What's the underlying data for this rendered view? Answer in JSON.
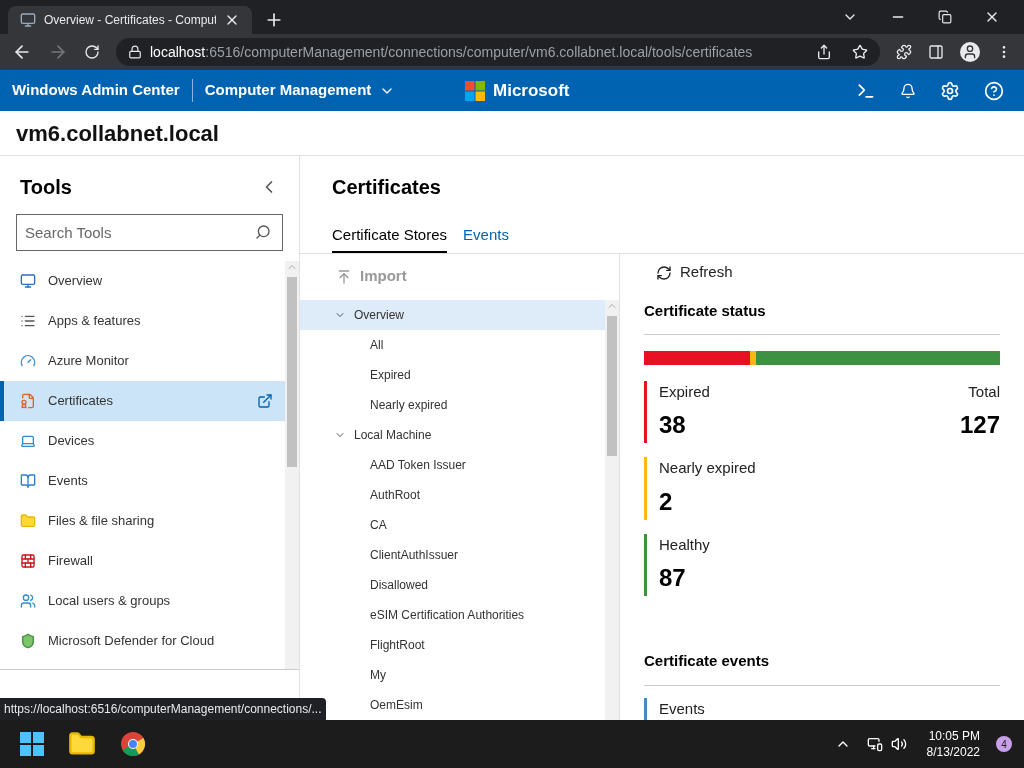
{
  "browser": {
    "tab_title": "Overview - Certificates - Comput",
    "address_host": "localhost",
    "address_path": ":6516/computerManagement/connections/computer/vm6.collabnet.local/tools/certificates",
    "status_url": "https://localhost:6516/computerManagement/connections/..."
  },
  "header": {
    "app_name": "Windows Admin Center",
    "context": "Computer Management",
    "brand": "Microsoft"
  },
  "server_name": "vm6.collabnet.local",
  "tools": {
    "title": "Tools",
    "search_placeholder": "Search Tools",
    "items": [
      {
        "label": "Overview",
        "selected": false
      },
      {
        "label": "Apps & features",
        "selected": false
      },
      {
        "label": "Azure Monitor",
        "selected": false
      },
      {
        "label": "Certificates",
        "selected": true
      },
      {
        "label": "Devices",
        "selected": false
      },
      {
        "label": "Events",
        "selected": false
      },
      {
        "label": "Files & file sharing",
        "selected": false
      },
      {
        "label": "Firewall",
        "selected": false
      },
      {
        "label": "Local users & groups",
        "selected": false
      },
      {
        "label": "Microsoft Defender for Cloud",
        "selected": false
      }
    ]
  },
  "page_title": "Certificates",
  "tabs": [
    {
      "label": "Certificate Stores",
      "selected": true
    },
    {
      "label": "Events",
      "selected": false
    }
  ],
  "import_label": "Import",
  "tree": [
    {
      "label": "Overview",
      "expanded": true,
      "selected": true,
      "children": [
        {
          "label": "All"
        },
        {
          "label": "Expired"
        },
        {
          "label": "Nearly expired"
        }
      ]
    },
    {
      "label": "Local Machine",
      "expanded": true,
      "selected": false,
      "children": [
        {
          "label": "AAD Token Issuer"
        },
        {
          "label": "AuthRoot"
        },
        {
          "label": "CA"
        },
        {
          "label": "ClientAuthIssuer"
        },
        {
          "label": "Disallowed"
        },
        {
          "label": "eSIM Certification Authorities"
        },
        {
          "label": "FlightRoot"
        },
        {
          "label": "My"
        },
        {
          "label": "OemEsim"
        }
      ]
    }
  ],
  "refresh_label": "Refresh",
  "status": {
    "title": "Certificate status",
    "total_label": "Total",
    "total": "127",
    "stats": [
      {
        "label": "Expired",
        "count": "38",
        "color": "#e81123",
        "level": 0.299
      },
      {
        "label": "Nearly expired",
        "count": "2",
        "color": "#fcb714",
        "level": 0.016
      },
      {
        "label": "Healthy",
        "count": "87",
        "color": "#3f9142",
        "level": 0.685
      }
    ]
  },
  "events": {
    "title": "Certificate events",
    "items": [
      {
        "label": "Events",
        "color": "#4a88c8"
      }
    ]
  },
  "taskbar": {
    "time": "10:05 PM",
    "date": "8/13/2022",
    "badge": "4"
  }
}
